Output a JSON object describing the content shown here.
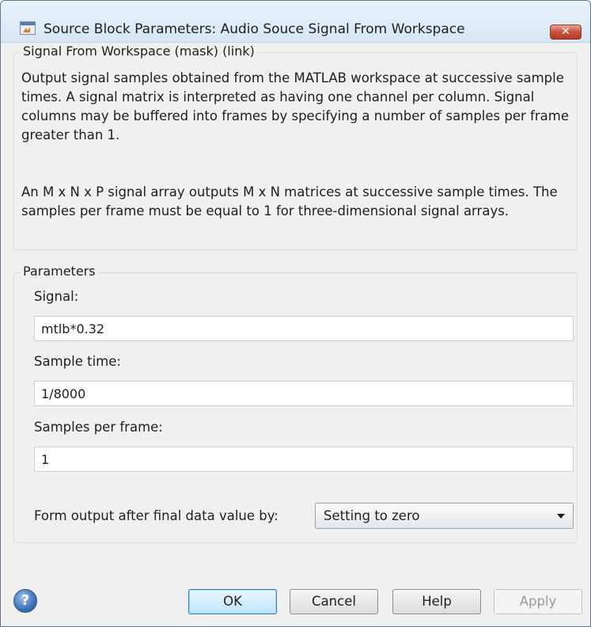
{
  "window": {
    "title": "Source Block Parameters: Audio Souce Signal From Workspace",
    "close_glyph": "✕"
  },
  "description_group": {
    "label": "Signal From Workspace (mask) (link)",
    "paragraph1": "Output signal samples obtained from the MATLAB workspace at successive sample times.  A signal matrix is interpreted as having one channel per column.  Signal columns may be buffered into frames by specifying a number of samples per frame greater than 1.",
    "paragraph2": "An M x N x P signal array outputs M x N matrices at successive sample times.  The samples per frame must be equal to 1 for three-dimensional signal arrays."
  },
  "parameters": {
    "label": "Parameters",
    "signal": {
      "label": "Signal:",
      "value": "mtlb*0.32"
    },
    "sample_time": {
      "label": "Sample time:",
      "value": "1/8000"
    },
    "samples_per_frame": {
      "label": "Samples per frame:",
      "value": "1"
    },
    "form_output": {
      "label": "Form output after final data value by:",
      "selected": "Setting to zero"
    }
  },
  "buttons": {
    "help_icon_glyph": "?",
    "ok": "OK",
    "cancel": "Cancel",
    "help": "Help",
    "apply": "Apply"
  }
}
